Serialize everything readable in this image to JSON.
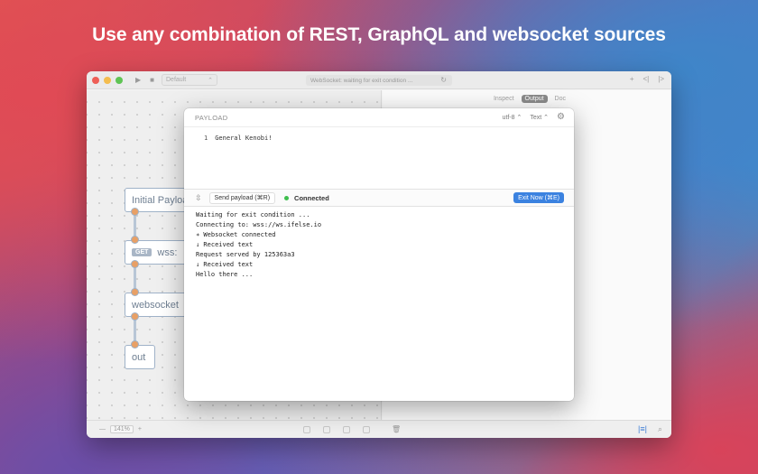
{
  "headline": "Use any combination of REST, GraphQL and websocket sources",
  "window": {
    "toolbar": {
      "play_icon": "▶",
      "stop_icon": "■",
      "scheme_label": "Default",
      "scheme_chevron": "⌃",
      "status_text": "WebSocket: waiting for exit condition ...",
      "reload_icon": "↻",
      "add_icon": "+",
      "left_panel_icon": "<|",
      "right_panel_icon": "|>"
    },
    "canvas": {
      "nodes": [
        {
          "label": "Initial Payloa"
        },
        {
          "badge": "GET",
          "label": "wss:"
        },
        {
          "label": "websocket"
        },
        {
          "label": "out"
        }
      ]
    },
    "inspector_tabs": [
      {
        "label": "Inspect"
      },
      {
        "label": "Output",
        "active": true
      },
      {
        "label": "Doc"
      }
    ],
    "bottombar": {
      "zoom_out": "—",
      "zoom_value": "141%",
      "zoom_in": "+",
      "trash_icon": "🗑",
      "right_icon_1": "|≡|",
      "search_icon": "⌕"
    }
  },
  "modal": {
    "title": "PAYLOAD",
    "encoding": "utf-8 ⌃",
    "format": "Text ⌃",
    "settings_icon": "⚙",
    "editor": {
      "line_number": "1",
      "line_text": "General Kenobi!"
    },
    "toolbar": {
      "split_icon": "⇳",
      "send_label": "Send payload (⌘R)",
      "status": "Connected",
      "status_color": "#3fbf4f",
      "exit_label": "Exit Now (⌘E)"
    },
    "log_lines": [
      "Waiting for exit condition ...",
      "Connecting to: wss://ws.ifelse.io",
      "∗ Websocket connected",
      "↓ Received text",
      "Request served by 125363a3",
      "↓ Received text",
      "Hello there ..."
    ]
  }
}
